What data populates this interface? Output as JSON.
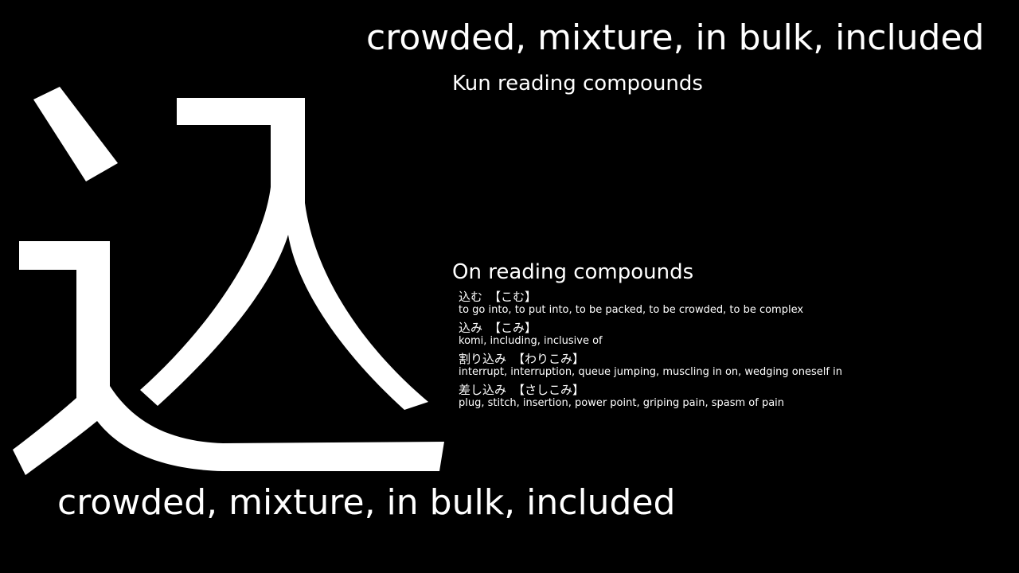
{
  "kanji": {
    "character": "込",
    "icon": "kanji-komu-glyph"
  },
  "meaning_top": "crowded, mixture, in bulk, included",
  "meaning_bottom": "crowded, mixture, in bulk, included",
  "kun_heading": "Kun reading compounds",
  "on_heading": "On reading compounds",
  "compounds": [
    {
      "word": "込む",
      "reading": "【こむ】",
      "gloss": "to go into, to put into, to be packed, to be crowded, to be complex"
    },
    {
      "word": "込み",
      "reading": "【こみ】",
      "gloss": "komi, including, inclusive of"
    },
    {
      "word": "割り込み",
      "reading": "【わりこみ】",
      "gloss": "interrupt, interruption, queue jumping, muscling in on, wedging oneself in"
    },
    {
      "word": "差し込み",
      "reading": "【さしこみ】",
      "gloss": "plug, stitch, insertion, power point, griping pain, spasm of pain"
    }
  ],
  "colors": {
    "background": "#000000",
    "foreground": "#ffffff"
  }
}
